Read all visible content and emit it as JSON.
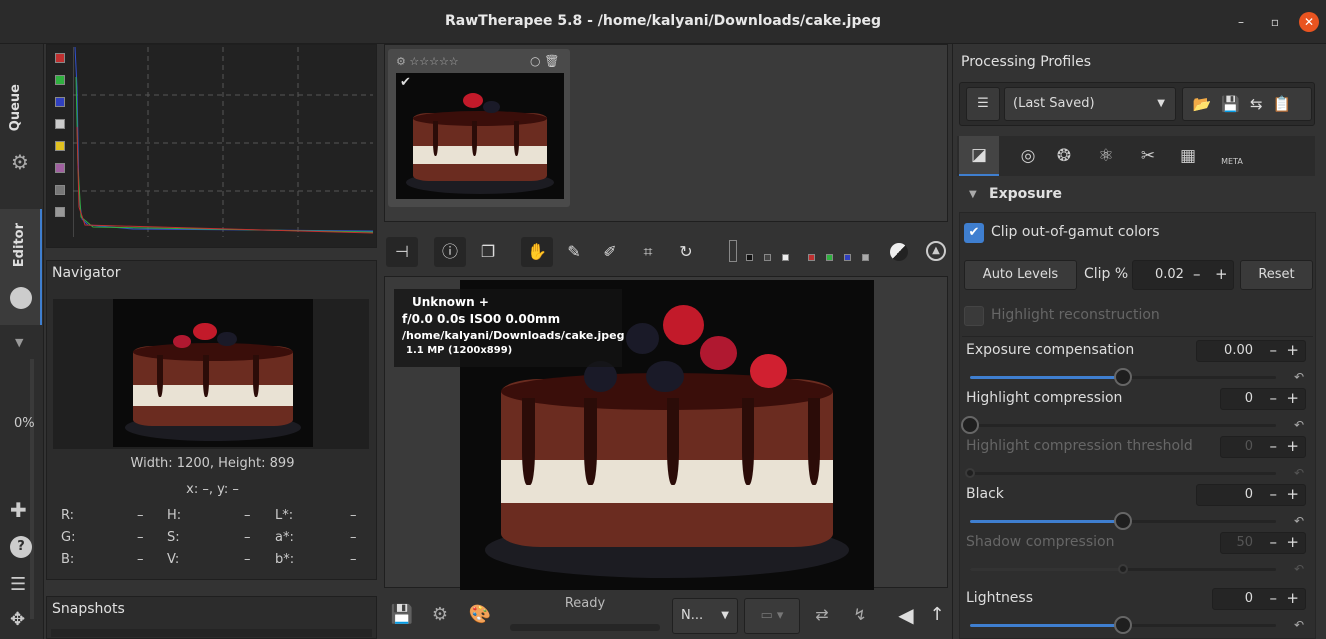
{
  "window": {
    "title": "RawTherapee 5.8 - /home/kalyani/Downloads/cake.jpeg"
  },
  "leftbar": {
    "queue_label": "Queue",
    "editor_label": "Editor",
    "progress": "0%"
  },
  "navigator": {
    "title": "Navigator",
    "size_text": "Width: 1200, Height: 899",
    "coords": "x: –, y: –",
    "rgb": [
      {
        "label": "R:",
        "value": "–"
      },
      {
        "label": "G:",
        "value": "–"
      },
      {
        "label": "B:",
        "value": "–"
      }
    ],
    "hsv": [
      {
        "label": "H:",
        "value": "–"
      },
      {
        "label": "S:",
        "value": "–"
      },
      {
        "label": "V:",
        "value": "–"
      }
    ],
    "lab": [
      {
        "label": "L*:",
        "value": "–"
      },
      {
        "label": "a*:",
        "value": "–"
      },
      {
        "label": "b*:",
        "value": "–"
      }
    ]
  },
  "snapshots": {
    "title": "Snapshots"
  },
  "preview_info": {
    "camera": "Unknown +",
    "exposure": "f/0.0  0.0s  ISO0  0.00mm",
    "path": "/home/kalyani/Downloads/cake.jpeg",
    "mp": "1.1 MP (1200x899)"
  },
  "status": {
    "ready": "Ready",
    "neutral_label": "N..."
  },
  "profiles": {
    "title": "Processing Profiles",
    "selected": "(Last Saved)"
  },
  "exposure": {
    "section_title": "Exposure",
    "clip_gamut": "Clip out-of-gamut colors",
    "auto_levels": "Auto Levels",
    "clip_label": "Clip %",
    "clip_value": "0.02",
    "reset": "Reset",
    "highlight_recon": "Highlight reconstruction",
    "rows": [
      {
        "label": "Exposure compensation",
        "value": "0.00",
        "fraction": 0.5,
        "enabled": true
      },
      {
        "label": "Highlight compression",
        "value": "0",
        "fraction": 0.0,
        "enabled": true
      },
      {
        "label": "Highlight compression threshold",
        "value": "0",
        "fraction": 0.0,
        "enabled": false
      },
      {
        "label": "Black",
        "value": "0",
        "fraction": 0.5,
        "enabled": true
      },
      {
        "label": "Shadow compression",
        "value": "50",
        "fraction": 0.5,
        "enabled": false
      },
      {
        "label": "Lightness",
        "value": "0",
        "fraction": 0.5,
        "enabled": true
      }
    ]
  },
  "colors": {
    "accent": "#3f7fd0",
    "close": "#e95420"
  }
}
